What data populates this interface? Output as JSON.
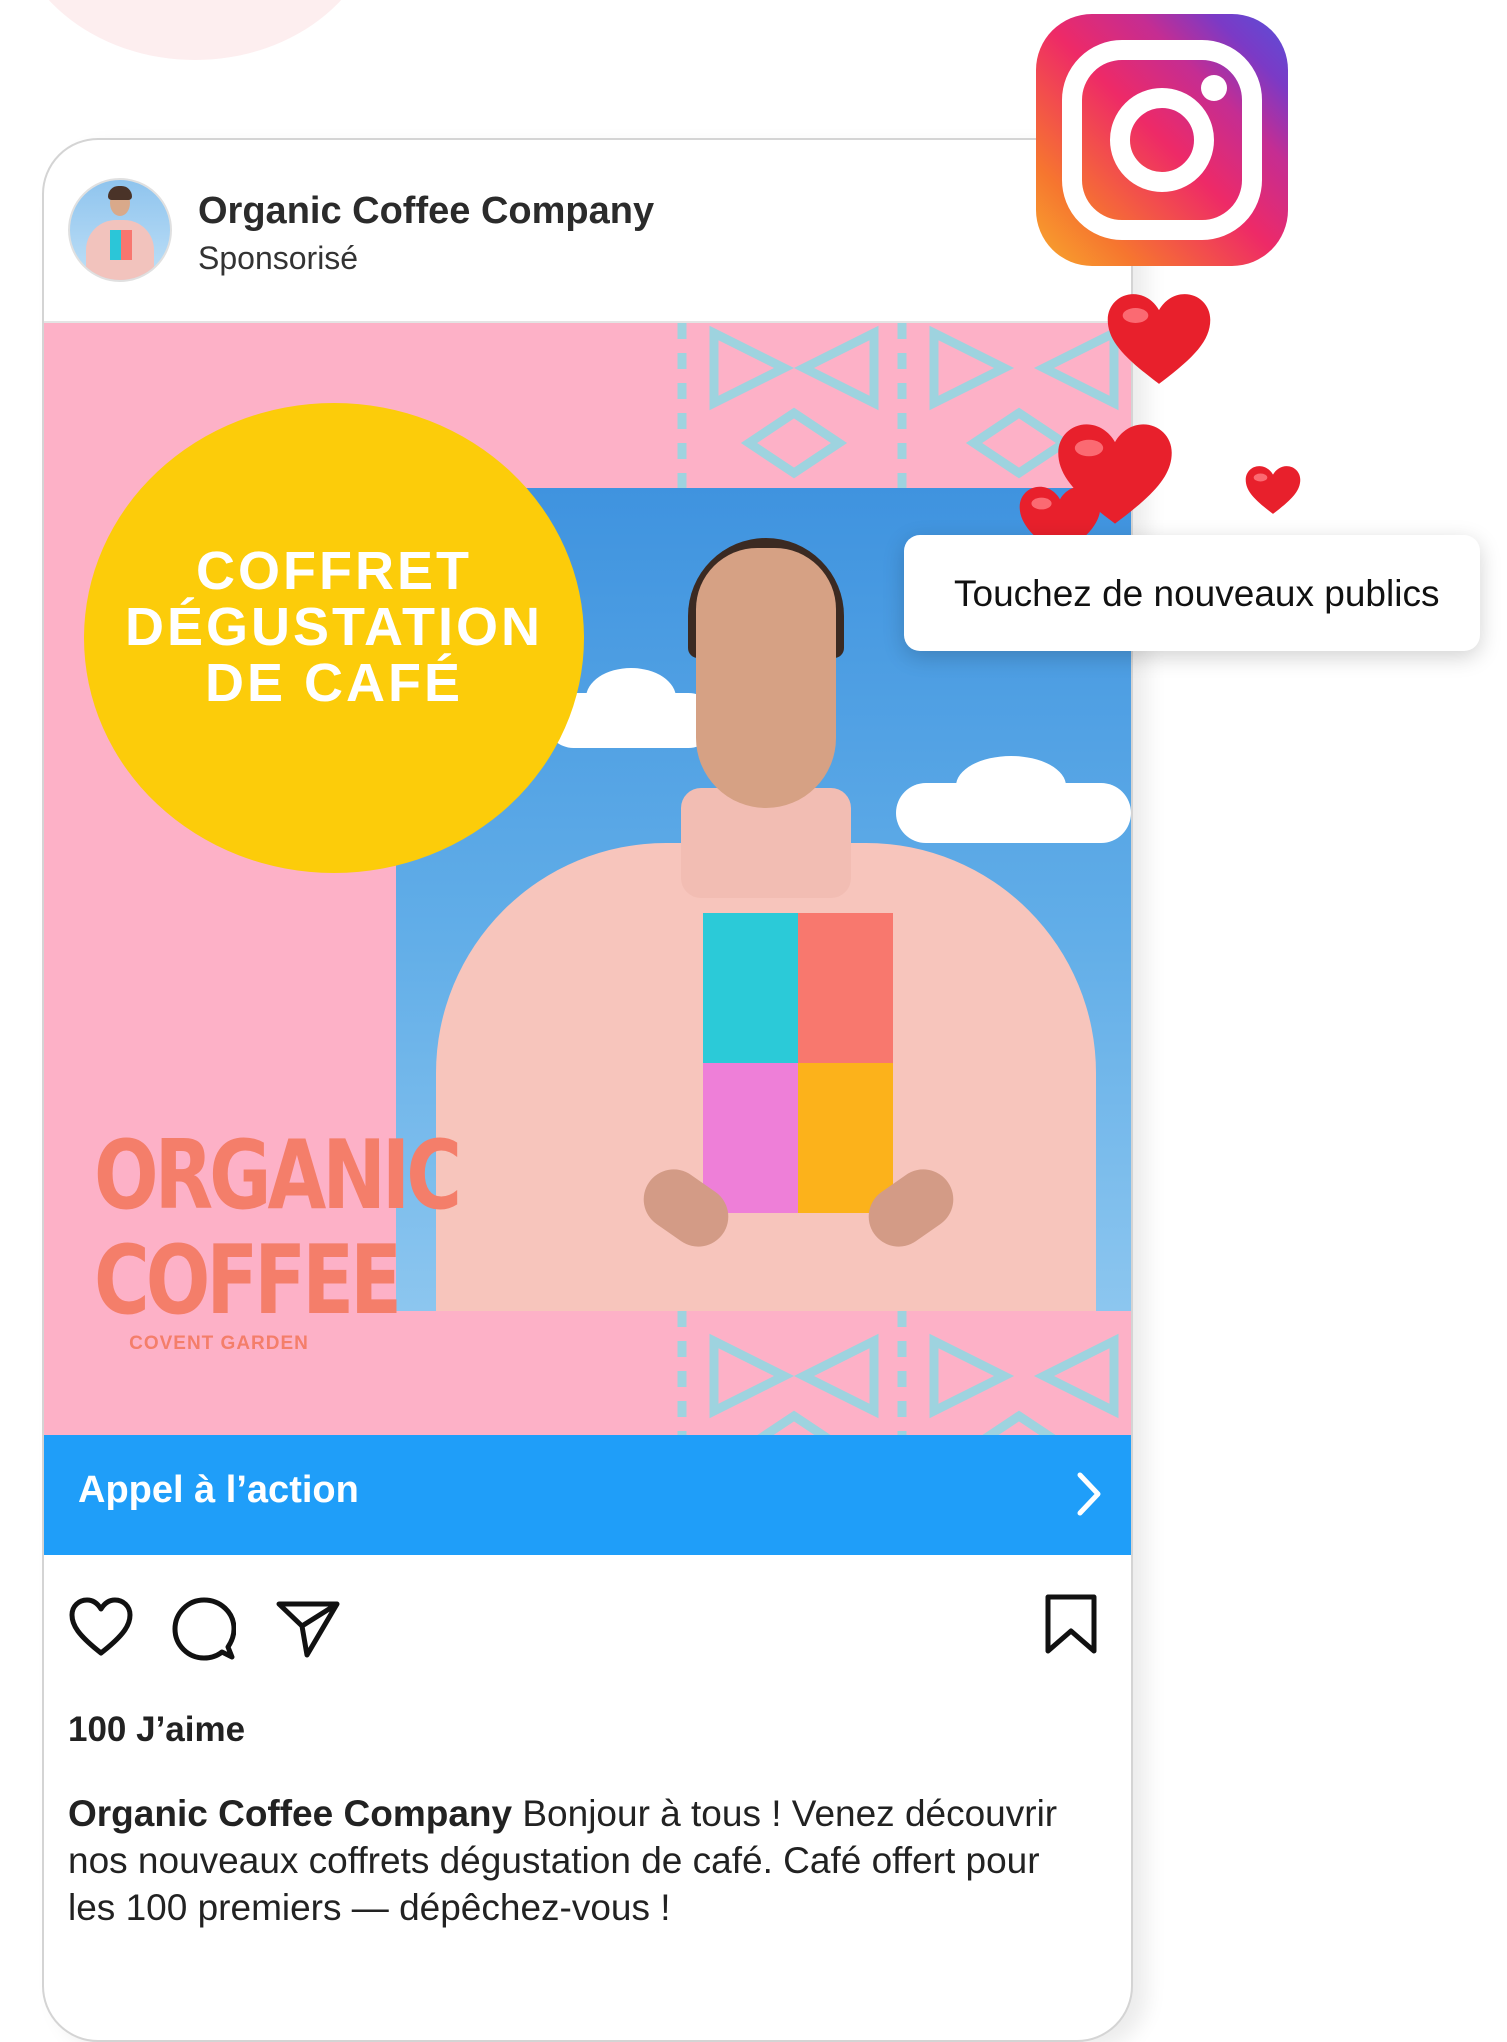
{
  "post": {
    "account_name": "Organic Coffee Company",
    "sponsored_label": "Sponsorisé",
    "ad": {
      "headline_line1": "COFFRET",
      "headline_line2": "DÉGUSTATION",
      "headline_line3": "DE CAFÉ",
      "logo_line1": "ORGANIC",
      "logo_line2": "COFFEE",
      "logo_subtitle": "COVENT GARDEN"
    },
    "cta_label": "Appel à l’action",
    "likes": "100 J’aime",
    "caption_author": "Organic Coffee Company",
    "caption_text": " Bonjour à tous ! Venez découvrir nos nouveaux coffrets dégustation de café. Café offert pour les 100 premiers — dépêchez-vous !"
  },
  "tooltip": {
    "text": "Touchez de nouveaux publics"
  },
  "icons": [
    "instagram-icon",
    "heart-icon",
    "comment-icon",
    "share-icon",
    "bookmark-icon",
    "chevron-right-icon"
  ],
  "colors": {
    "cta_blue": "#1f9ef9",
    "ad_pink": "#fdb1c7",
    "badge_yellow": "#fccc0a",
    "logo_coral": "#f47e6a",
    "heart_red": "#e8202c"
  }
}
